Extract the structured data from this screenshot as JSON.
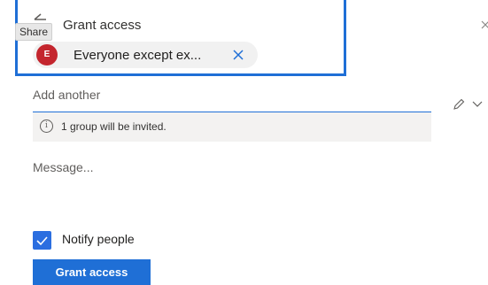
{
  "header": {
    "back_icon": "back-arrow-icon",
    "tooltip": "Share",
    "title": "Grant access",
    "close_icon": "close-icon"
  },
  "recipient_chip": {
    "avatar_initial": "E",
    "avatar_color": "#c4262e",
    "label": "Everyone except ex...",
    "remove_icon": "close-icon"
  },
  "add_another": {
    "placeholder": "Add another"
  },
  "info": {
    "icon": "info-icon",
    "icon_glyph": "i",
    "text": "1 group will be invited."
  },
  "permissions": {
    "icon": "pencil-icon",
    "dropdown_icon": "chevron-down-icon"
  },
  "message": {
    "placeholder": "Message..."
  },
  "notify": {
    "label": "Notify people",
    "checked": true
  },
  "actions": {
    "grant_label": "Grant access"
  },
  "colors": {
    "accent": "#1f6fd6",
    "checkbox": "#2b6ee0"
  }
}
